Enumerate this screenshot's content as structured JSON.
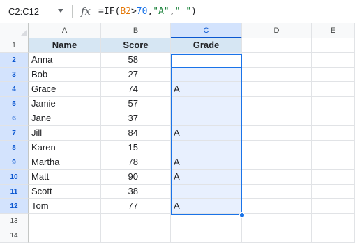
{
  "formula_bar": {
    "name_box": "C2:C12",
    "fx_label": "fx",
    "formula_parts": {
      "prefix": "=IF(",
      "ref": "B2",
      "op": ">",
      "num": "70",
      "sep1": ",",
      "str1": "\"A\"",
      "sep2": ",",
      "str2": "\" \"",
      "suffix": ")"
    }
  },
  "columns": [
    "A",
    "B",
    "C",
    "D",
    "E"
  ],
  "rows": [
    "1",
    "2",
    "3",
    "4",
    "5",
    "6",
    "7",
    "8",
    "9",
    "10",
    "11",
    "12",
    "13",
    "14"
  ],
  "selected_column": "C",
  "selected_rows": [
    "2",
    "3",
    "4",
    "5",
    "6",
    "7",
    "8",
    "9",
    "10",
    "11",
    "12"
  ],
  "table": {
    "headers": [
      "Name",
      "Score",
      "Grade"
    ],
    "records": [
      {
        "name": "Anna",
        "score": "58",
        "grade": ""
      },
      {
        "name": "Bob",
        "score": "27",
        "grade": ""
      },
      {
        "name": "Grace",
        "score": "74",
        "grade": "A"
      },
      {
        "name": "Jamie",
        "score": "57",
        "grade": ""
      },
      {
        "name": "Jane",
        "score": "37",
        "grade": ""
      },
      {
        "name": "Jill",
        "score": "84",
        "grade": "A"
      },
      {
        "name": "Karen",
        "score": "15",
        "grade": ""
      },
      {
        "name": "Martha",
        "score": "78",
        "grade": "A"
      },
      {
        "name": "Matt",
        "score": "90",
        "grade": "A"
      },
      {
        "name": "Scott",
        "score": "38",
        "grade": ""
      },
      {
        "name": "Tom",
        "score": "77",
        "grade": "A"
      }
    ]
  },
  "colors": {
    "header_fill": "#d6e6f3",
    "selection": "#1a73e8",
    "selection_fill": "#e8f0fe"
  }
}
